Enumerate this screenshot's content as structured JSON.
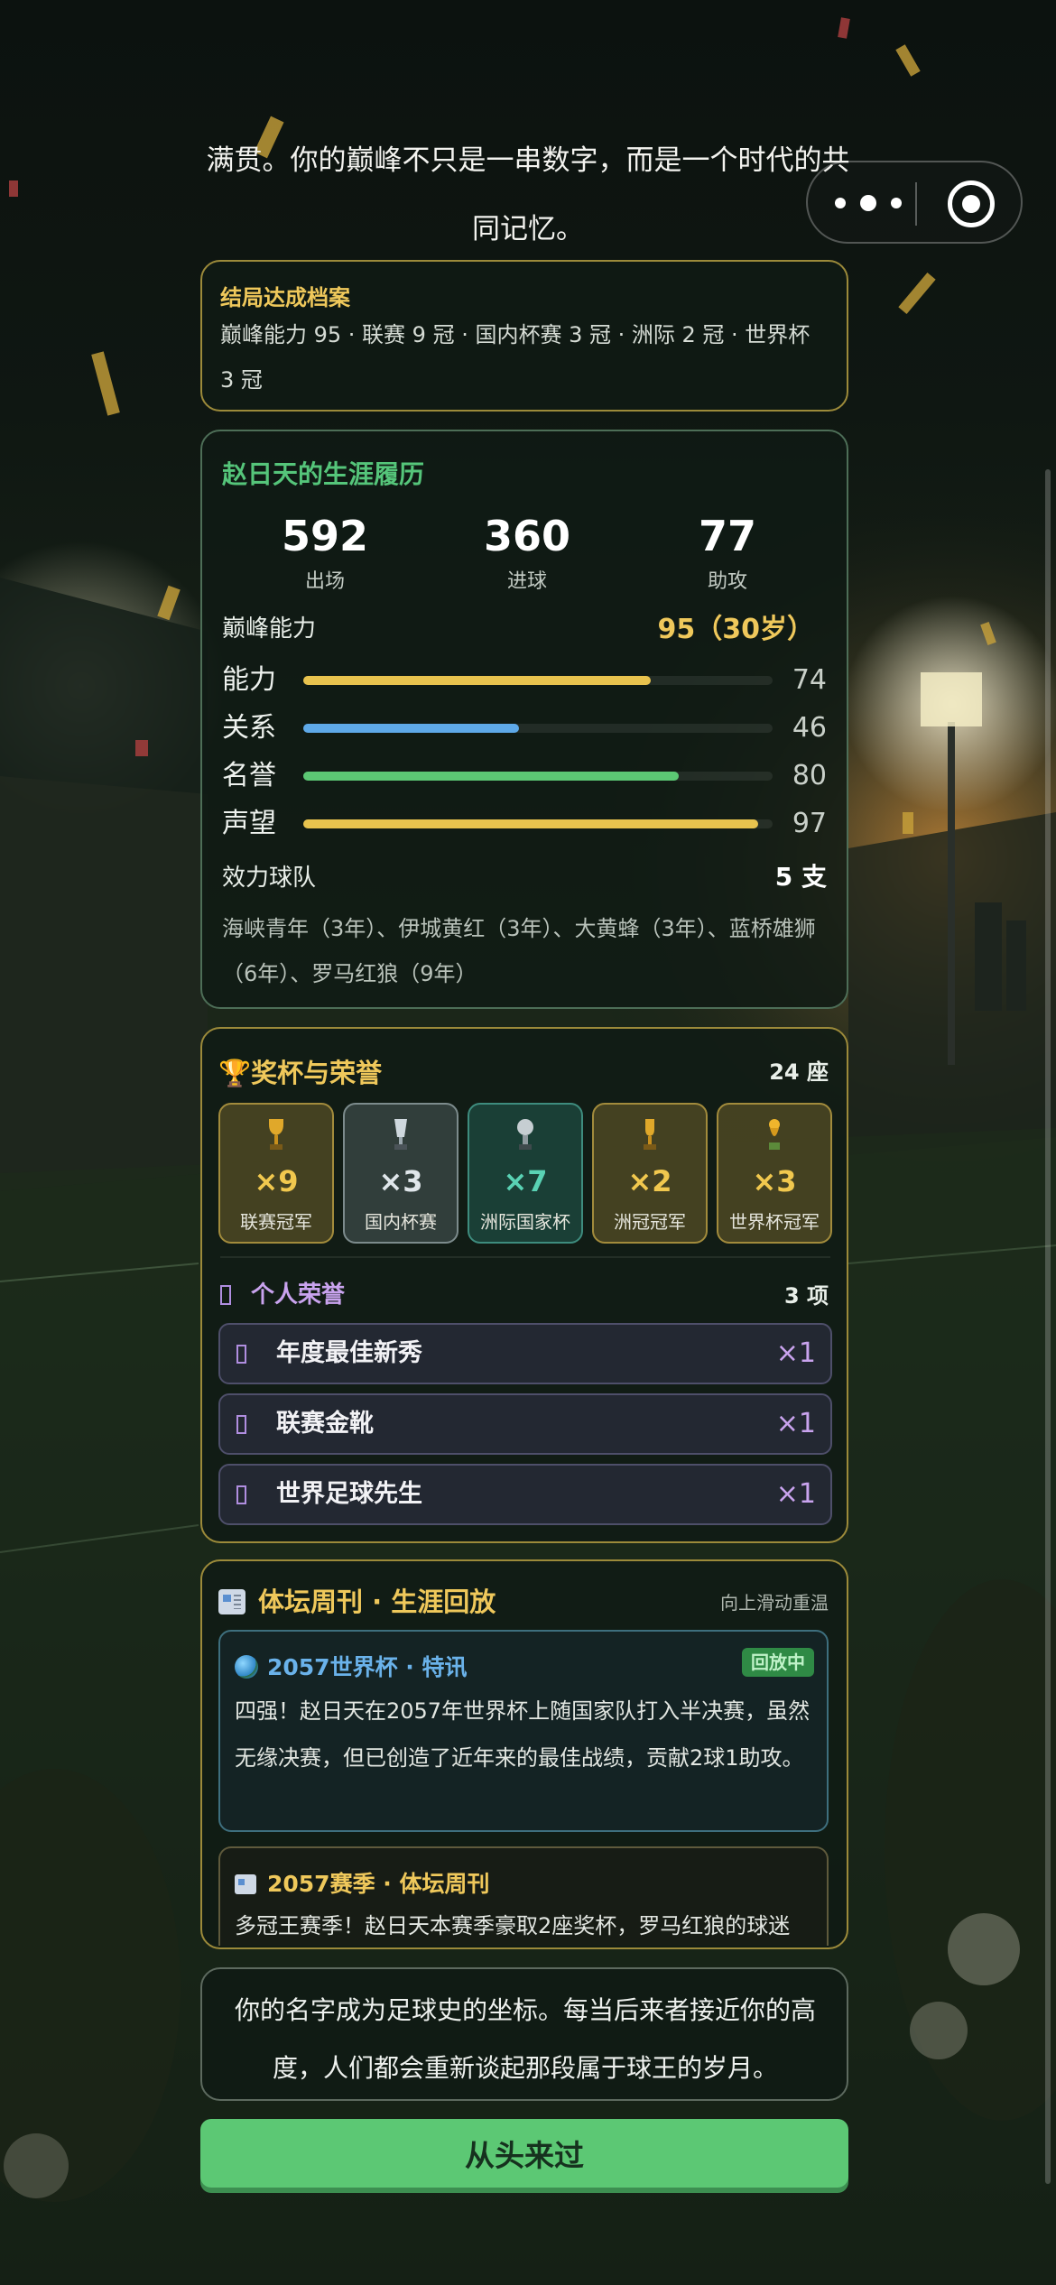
{
  "intro": {
    "line1": "满贯。你的巅峰不只是一串数字，而是一个时代的共",
    "line2": "同记忆。"
  },
  "archive": {
    "title": "结局达成档案",
    "text": "巅峰能力 95 · 联赛 9 冠 · 国内杯赛 3 冠 · 洲际 2 冠 · 世界杯 3 冠"
  },
  "career": {
    "title": "赵日天的生涯履历",
    "stats": [
      {
        "value": "592",
        "label": "出场"
      },
      {
        "value": "360",
        "label": "进球"
      },
      {
        "value": "77",
        "label": "助攻"
      }
    ],
    "peak_label": "巅峰能力",
    "peak_value": "95（30岁）",
    "bars": [
      {
        "label": "能力",
        "value": 74,
        "value_text": "74",
        "color": "#e8c34e"
      },
      {
        "label": "关系",
        "value": 46,
        "value_text": "46",
        "color": "#5ea9e8"
      },
      {
        "label": "名誉",
        "value": 80,
        "value_text": "80",
        "color": "#5cc874"
      },
      {
        "label": "声望",
        "value": 97,
        "value_text": "97",
        "color": "#e8c34e"
      }
    ],
    "teams_label": "效力球队",
    "teams_count": "5 支",
    "teams_list": "海峡青年（3年）、伊城黄红（3年）、大黄蜂（3年）、蓝桥雄狮（6年）、罗马红狼（9年）"
  },
  "trophies": {
    "title": "奖杯与荣誉",
    "count": "24 座",
    "items": [
      {
        "count": "×9",
        "label": "联赛冠军",
        "style": "gold",
        "icon": "trophy-icon"
      },
      {
        "count": "×3",
        "label": "国内杯赛",
        "style": "silver",
        "icon": "cup-icon"
      },
      {
        "count": "×7",
        "label": "洲际国家杯",
        "style": "teal",
        "icon": "globe-trophy-icon"
      },
      {
        "count": "×2",
        "label": "洲冠冠军",
        "style": "gold",
        "icon": "trophy-icon"
      },
      {
        "count": "×3",
        "label": "世界杯冠军",
        "style": "gold",
        "icon": "world-cup-icon"
      }
    ],
    "honors_title": "个人荣誉",
    "honors_count": "3 项",
    "honors": [
      {
        "name": "年度最佳新秀",
        "count": "×1"
      },
      {
        "name": "联赛金靴",
        "count": "×1"
      },
      {
        "name": "世界足球先生",
        "count": "×1"
      }
    ]
  },
  "news": {
    "title": "体坛周刊 · 生涯回放",
    "hint": "向上滑动重温",
    "items": [
      {
        "header": "2057世界杯 · 特讯",
        "badge": "回放中",
        "body": "四强！赵日天在2057年世界杯上随国家队打入半决赛，虽然无缘决赛，但已创造了近年来的最佳战绩，贡献2球1助攻。"
      },
      {
        "header": "2057赛季 · 体坛周刊",
        "body": "多冠王赛季！赵日天本赛季豪取2座奖杯，罗马红狼的球迷"
      }
    ]
  },
  "closing": "你的名字成为足球史的坐标。每当后来者接近你的高度，人们都会重新谈起那段属于球王的岁月。",
  "restart_label": "从头来过"
}
